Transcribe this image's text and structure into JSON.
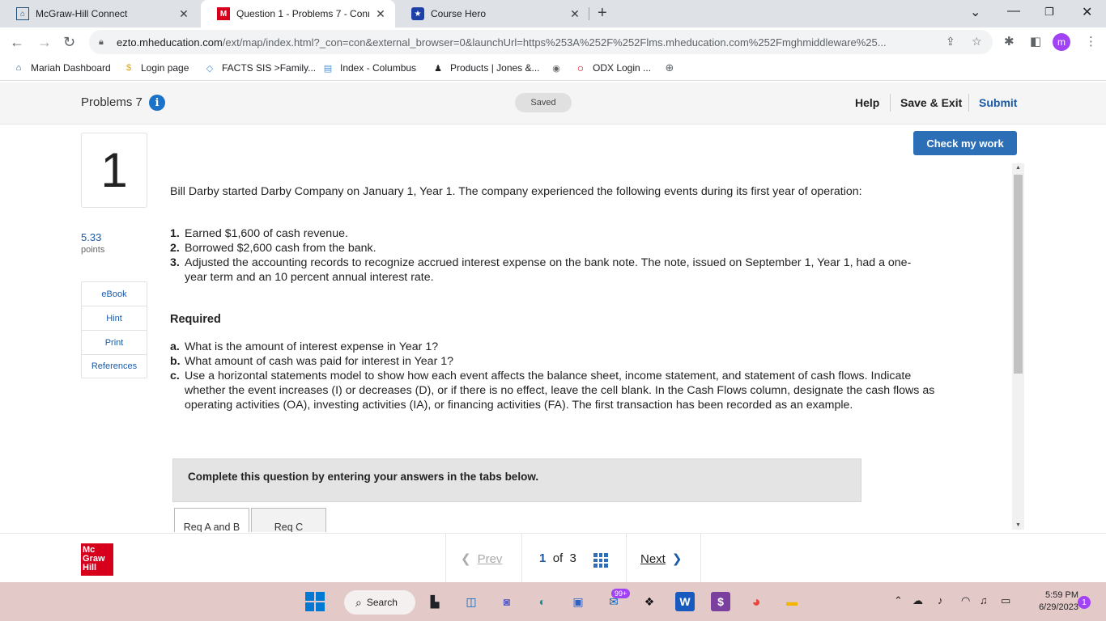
{
  "browser": {
    "tabs": [
      {
        "title": "McGraw-Hill Connect",
        "icon": "connect-home-icon"
      },
      {
        "title": "Question 1 - Problems 7 - Conne",
        "icon": "mcgraw-hill-m-icon"
      },
      {
        "title": "Course Hero",
        "icon": "course-hero-star-icon"
      }
    ],
    "url_host": "ezto.mheducation.com",
    "url_rest": "/ext/map/index.html?_con=con&external_browser=0&launchUrl=https%253A%252F%252Flms.mheducation.com%252Fmghmiddleware%25...",
    "profile_initial": "m",
    "bookmarks": [
      "Mariah Dashboard",
      "Login page",
      "FACTS SIS >Family...",
      "Index - Columbus",
      "Products | Jones &...",
      "",
      "ODX Login ..."
    ]
  },
  "header": {
    "title": "Problems 7",
    "status": "Saved",
    "help": "Help",
    "save_exit": "Save & Exit",
    "submit": "Submit"
  },
  "question": {
    "number": "1",
    "points_value": "5.33",
    "points_label": "points",
    "side_links": [
      "eBook",
      "Hint",
      "Print",
      "References"
    ],
    "check_label": "Check my work",
    "intro": "Bill Darby started Darby Company on January 1, Year 1. The company experienced the following events during its first year of operation:",
    "events": [
      {
        "n": "1.",
        "text": "Earned $1,600 of cash revenue."
      },
      {
        "n": "2.",
        "text": "Borrowed $2,600 cash from the bank."
      },
      {
        "n": "3.",
        "text": "Adjusted the accounting records to recognize accrued interest expense on the bank note. The note, issued on September 1, Year 1, had a one-year term and an 10 percent annual interest rate."
      }
    ],
    "required_label": "Required",
    "requirements": [
      {
        "n": "a.",
        "text": "What is the amount of interest expense in Year 1?"
      },
      {
        "n": "b.",
        "text": "What amount of cash was paid for interest in Year 1?"
      },
      {
        "n": "c.",
        "text": "Use a horizontal statements model to show how each event affects the balance sheet, income statement, and statement of cash flows. Indicate whether the event increases (I) or decreases (D), or if there is no effect, leave the cell blank. In the Cash Flows column, designate the cash flows as operating activities (OA), investing activities (IA), or financing activities (FA). The first transaction has been recorded as an example."
      }
    ],
    "complete_prompt": "Complete this question by entering your answers in the tabs below.",
    "tabs": [
      "Req A and B",
      "Req C"
    ]
  },
  "footer": {
    "prev": "Prev",
    "current": "1",
    "of": "of",
    "total": "3",
    "next": "Next",
    "logo_lines": [
      "Mc",
      "Graw",
      "Hill"
    ]
  },
  "taskbar": {
    "search": "Search",
    "mail_badge": "99+",
    "time": "5:59 PM",
    "date": "6/29/2023",
    "notifications": "1"
  }
}
